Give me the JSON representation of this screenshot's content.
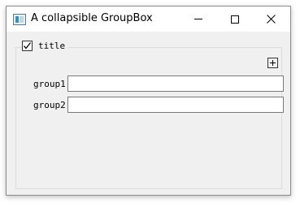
{
  "window": {
    "title": "A collapsible GroupBox",
    "app_icon": "qt-window-icon",
    "controls": [
      "minimize-icon",
      "maximize-icon",
      "close-icon"
    ],
    "close_glyph": "✕"
  },
  "groupbox": {
    "title": "title",
    "checked": true,
    "collapse_button_glyph": "plus-icon",
    "rows": [
      {
        "label": "group1",
        "value": ""
      },
      {
        "label": "group2",
        "value": ""
      }
    ]
  }
}
